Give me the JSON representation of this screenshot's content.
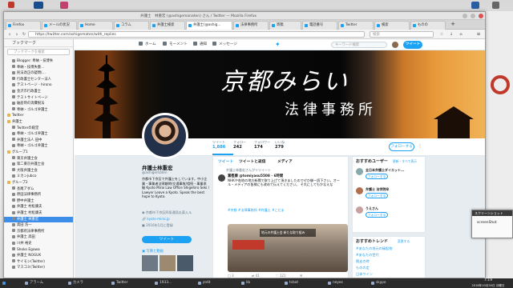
{
  "window": {
    "title": "弁護士　林重宏 (@ashigemanaten) さん / Twitter — Mozilla Firefox"
  },
  "tabs": [
    {
      "label": "Firefox"
    },
    {
      "label": "メールの状況"
    },
    {
      "label": "Home"
    },
    {
      "label": "コラム"
    },
    {
      "label": "弁護士検索"
    },
    {
      "label": "弁護士(@ashig..."
    },
    {
      "label": "法律事務所"
    },
    {
      "label": "寄稿"
    },
    {
      "label": "電話番号"
    },
    {
      "label": "Twitter"
    },
    {
      "label": "検索"
    },
    {
      "label": "ものの"
    }
  ],
  "navbar": {
    "url": "https://twitter.com/ashigematen/with_replies",
    "search_placeholder": "検索"
  },
  "sidebar": {
    "title": "ブックマーク",
    "search_placeholder": "ブックマークを検索",
    "items": [
      {
        "label": "Blogger: 奉納・技博失",
        "type": "link"
      },
      {
        "label": "奉納・技博失墨...",
        "type": "link"
      },
      {
        "label": "民法改正の疑問(...",
        "type": "link"
      },
      {
        "label": "行政書士センター法人",
        "type": "link"
      },
      {
        "label": "テストページ - hirono",
        "type": "link"
      },
      {
        "label": "金沢市行政書士",
        "type": "link"
      },
      {
        "label": "テストサイトページ",
        "type": "link"
      },
      {
        "label": "破産時の消費税法",
        "type": "link"
      },
      {
        "label": "奉納・ゴルゴ弁護士",
        "type": "link"
      },
      {
        "label": "Twitter",
        "type": "folder"
      },
      {
        "label": "弁護士",
        "type": "folder"
      },
      {
        "label": "Twitterの殿堂",
        "type": "link"
      },
      {
        "label": "奉納・ゴルゴ弁護士",
        "type": "link"
      },
      {
        "label": "弁護士法人 田中",
        "type": "link"
      },
      {
        "label": "奉納・ゴルゴ弁護士",
        "type": "link"
      },
      {
        "label": "グループ1",
        "type": "folder"
      },
      {
        "label": "東京弁護士会",
        "type": "link"
      },
      {
        "label": "第二東京弁護士会",
        "type": "link"
      },
      {
        "label": "大阪弁護士会",
        "type": "link"
      },
      {
        "label": "ミカンjubco",
        "type": "link"
      },
      {
        "label": "グループ2",
        "type": "folder"
      },
      {
        "label": "長尾アダム",
        "type": "link"
      },
      {
        "label": "原田法律事務所",
        "type": "link"
      },
      {
        "label": "野中弁護士",
        "type": "link"
      },
      {
        "label": "弁護士 村松康夫",
        "type": "link"
      },
      {
        "label": "弁護士 村松康夫",
        "type": "link"
      },
      {
        "label": "弁護士 林重宏",
        "type": "link",
        "selected": true
      },
      {
        "label": "奥田 浩一",
        "type": "link"
      },
      {
        "label": "京都府法律事務所",
        "type": "link"
      },
      {
        "label": "弁護士 高田",
        "type": "link"
      },
      {
        "label": "川井 裕史",
        "type": "link"
      },
      {
        "label": "Shoko Egawa",
        "type": "link"
      },
      {
        "label": "弁護士 NOGUK",
        "type": "link"
      },
      {
        "label": "サイモン(Twitter)",
        "type": "link"
      },
      {
        "label": "マスコミ(Twitter)",
        "type": "link"
      }
    ]
  },
  "twitter": {
    "nav": {
      "home": "ホーム",
      "moments": "モーメント",
      "notifications": "通知",
      "messages": "メッセージ",
      "search_placeholder": "キーワード検索",
      "tweet_button": "ツイート"
    },
    "banner": {
      "line1": "京都みらい",
      "line2": "法律事務所"
    },
    "stats": [
      {
        "label": "ツイート",
        "value": "1,886"
      },
      {
        "label": "フォロー",
        "value": "242"
      },
      {
        "label": "フォロワー",
        "value": "174"
      },
      {
        "label": "いいね",
        "value": "279"
      }
    ],
    "follow_button": "フォローする",
    "profile": {
      "name": "弁護士林重宏",
      "handle": "@ashigematen",
      "bio": "京都市下京区で弁護士をしています。中小企業・事業者法律顧問/交通事故/相続・事業承継 Kyoto Mirai Law Office Shigehiro Seki / Lawyer Leave a Kyoto. Speak the best hope to Kyoto.",
      "location": "京都市下京区四条通烏丸東入ル",
      "url": "kyoto-mirai.jp",
      "joined": "2016年1月に登録",
      "tweet_button": "ツイート",
      "media_label": "写真と動画"
    },
    "timeline": {
      "tabs": [
        "ツイート",
        "ツイートと返信",
        "メディア"
      ],
      "context": "弁護士林重宏さんがリツイート",
      "author": "富樫康 @tomiyasu5508 · 6時間",
      "text": "NHKや各地の地方新聞で取り上げて頂きましたのでぜひ御一読下さい。オール・メディアの皆様にも改めて伝えてください。 それにしてもかなえな",
      "tags": "#京都 #法律事務所 #弁護士 #こだま",
      "media_caption": "地元の弁護士会 新たな取り組み",
      "actions": {
        "reply": "3",
        "retweet": "41",
        "like": "121"
      }
    },
    "who_to_follow": {
      "title": "おすすめユーザー",
      "refresh": "更新・すべて表示",
      "users": [
        {
          "name": "全日本弁護士ダイエット...",
          "button": "フォローする"
        },
        {
          "name": "弁護士 法学院卒",
          "button": "フォローする"
        },
        {
          "name": "うえさん",
          "button": "フォローする"
        }
      ]
    },
    "trends": {
      "title": "おすすめトレンド",
      "change": "変更する",
      "items": [
        "#あなたの地元の縁起物",
        "#あなたの世代",
        "競走の時",
        "ものの定",
        "日本ワイン"
      ]
    }
  },
  "floating_window": {
    "title": "スクリーンショット",
    "text": "screenShot"
  },
  "taskbar": {
    "items": [
      "アラーム",
      "カメラ",
      "Twitter",
      "1933...",
      "jedit",
      "lib",
      "tcbot",
      "neyes",
      "skype"
    ],
    "clock_time": "7:19",
    "clock_date": "2018年10月30日 月曜日"
  }
}
